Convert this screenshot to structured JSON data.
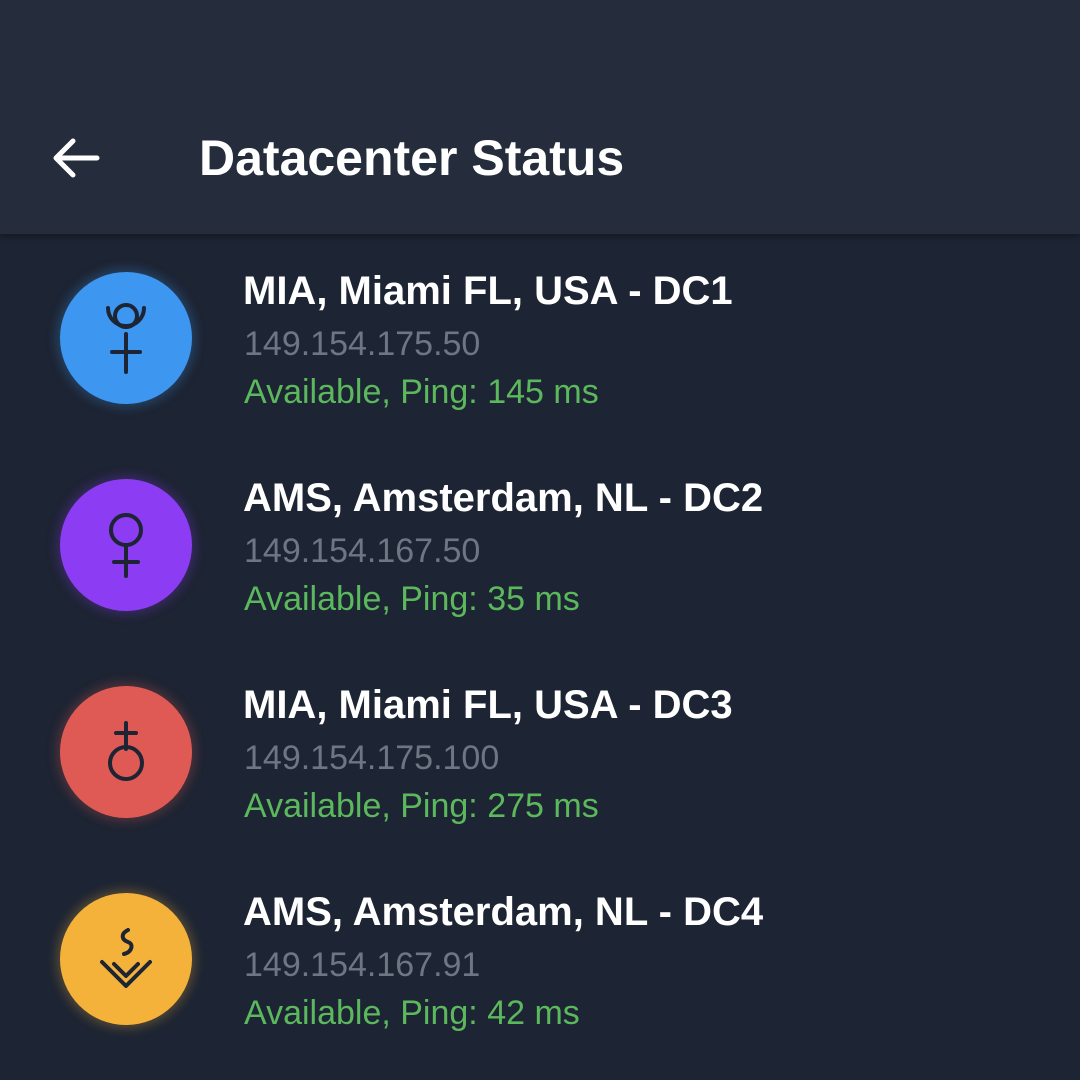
{
  "header": {
    "title": "Datacenter Status",
    "back_icon": "arrow-left-icon"
  },
  "datacenters": [
    {
      "name": "MIA, Miami FL, USA - DC1",
      "ip": "149.154.175.50",
      "status": "Available, Ping: 145 ms",
      "color": "#3d96f0",
      "icon": "pluto-symbol-icon"
    },
    {
      "name": "AMS, Amsterdam, NL - DC2",
      "ip": "149.154.167.50",
      "status": "Available, Ping: 35 ms",
      "color": "#8c3cf2",
      "icon": "venus-symbol-icon"
    },
    {
      "name": "MIA, Miami FL, USA - DC3",
      "ip": "149.154.175.100",
      "status": "Available, Ping: 275 ms",
      "color": "#e05a55",
      "icon": "earth-symbol-icon"
    },
    {
      "name": "AMS, Amsterdam, NL - DC4",
      "ip": "149.154.167.91",
      "status": "Available, Ping: 42 ms",
      "color": "#f4b23a",
      "icon": "ceres-symbol-icon"
    }
  ],
  "colors": {
    "background": "#1d2433",
    "appbar": "#252c3b",
    "status_green": "#5cb85c",
    "ip_gray": "#6e7684"
  }
}
